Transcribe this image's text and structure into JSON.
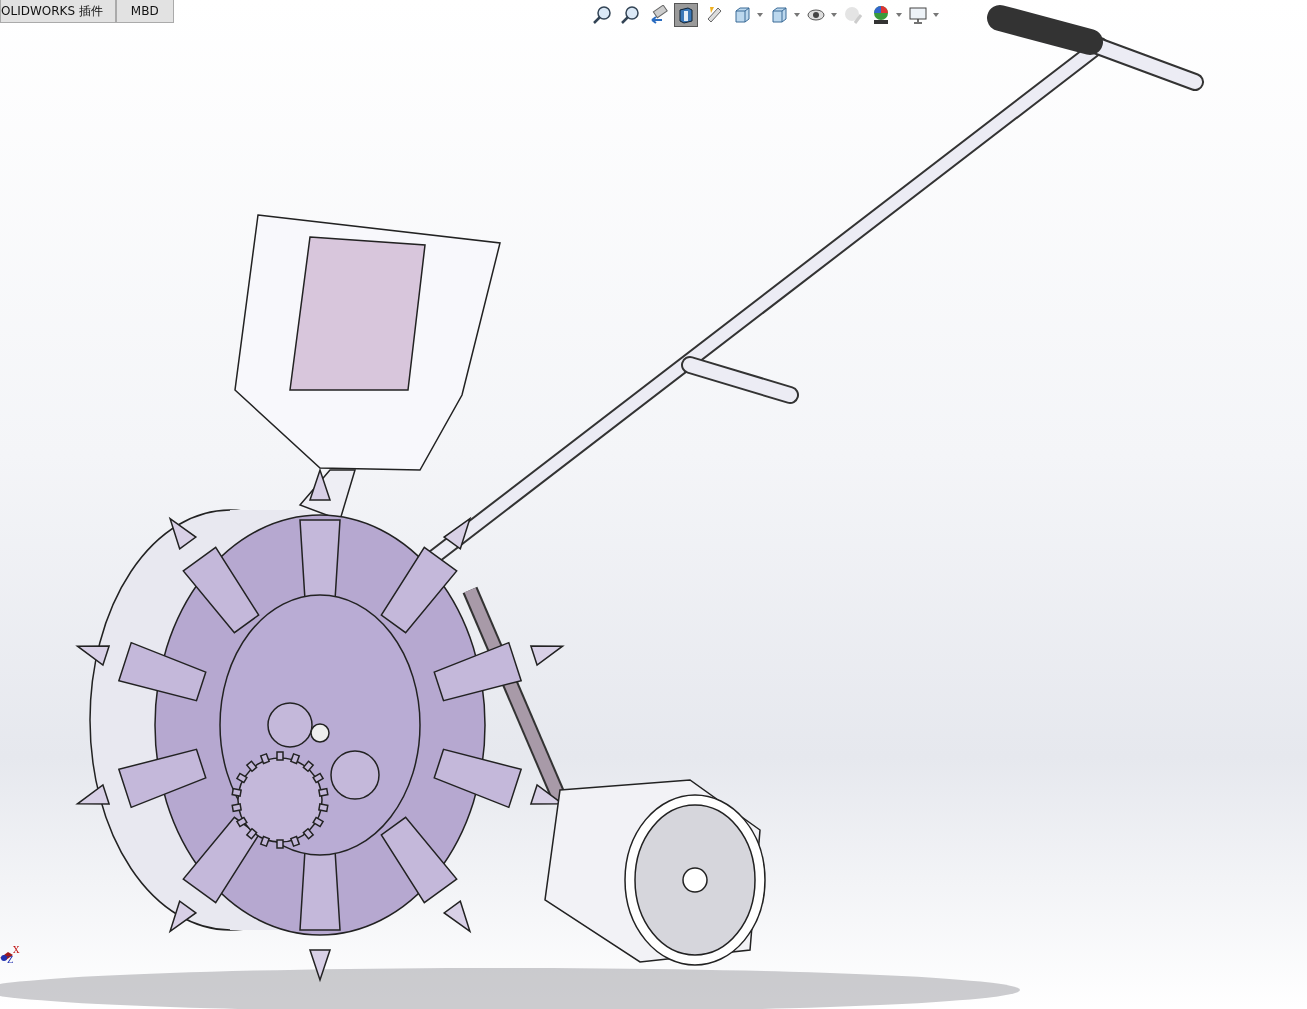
{
  "tabs": [
    {
      "label": "OLIDWORKS 插件",
      "selected": false
    },
    {
      "label": "MBD",
      "selected": false
    }
  ],
  "view_toolbar": [
    {
      "kind": "zoom-fit",
      "pressed": false,
      "dropdown": false
    },
    {
      "kind": "zoom-area",
      "pressed": false,
      "dropdown": false
    },
    {
      "kind": "previous-view",
      "pressed": false,
      "dropdown": false
    },
    {
      "kind": "section-view",
      "pressed": true,
      "dropdown": false
    },
    {
      "kind": "dynamic-annotation",
      "pressed": false,
      "dropdown": false
    },
    {
      "kind": "view-orientation",
      "pressed": false,
      "dropdown": true
    },
    {
      "kind": "display-style",
      "pressed": false,
      "dropdown": true
    },
    {
      "kind": "hide-show",
      "pressed": false,
      "dropdown": true
    },
    {
      "kind": "edit-appearance",
      "pressed": false,
      "dropdown": false
    },
    {
      "kind": "scene",
      "pressed": false,
      "dropdown": true
    },
    {
      "kind": "view-settings",
      "pressed": false,
      "dropdown": true
    }
  ],
  "triad": {
    "x_label": "X",
    "z_label": "Z"
  }
}
